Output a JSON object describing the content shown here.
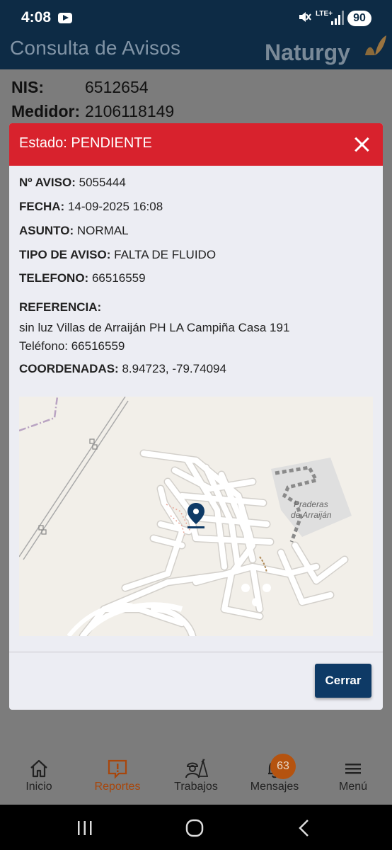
{
  "status_bar": {
    "time": "4:08",
    "network": "LTE+",
    "battery": "90"
  },
  "app": {
    "title": "Consulta de Avisos",
    "brand": "Naturgy"
  },
  "background": {
    "nis_label": "NIS:",
    "nis_value": "6512654",
    "medidor_label": "Medidor:",
    "medidor_value": "2106118149"
  },
  "modal": {
    "title": "Estado: PENDIENTE",
    "header_color": "#d8222d",
    "fields": [
      {
        "label": "Nº AVISO:",
        "value": "5055444"
      },
      {
        "label": "FECHA:",
        "value": "14-09-2025 16:08"
      },
      {
        "label": "ASUNTO:",
        "value": "NORMAL"
      },
      {
        "label": "TIPO DE AVISO:",
        "value": "FALTA DE FLUIDO"
      },
      {
        "label": "TELEFONO:",
        "value": "66516559"
      }
    ],
    "referencia_label": "REFERENCIA:",
    "referencia_line1": "sin luz Villas de Arraiján PH LA Campiña Casa 191",
    "referencia_line2": "Teléfono: 66516559",
    "coordenadas_label": "COORDENADAS:",
    "coordenadas_value": "8.94723, -79.74094",
    "map": {
      "place_line1": "Praderas",
      "place_line2": "de Arraiján",
      "marker_icon": "location-pin-icon"
    },
    "close_button": "Cerrar"
  },
  "bottom_nav": {
    "items": [
      {
        "label": "Inicio",
        "icon": "home-icon"
      },
      {
        "label": "Reportes",
        "icon": "report-alert-icon",
        "active": true
      },
      {
        "label": "Trabajos",
        "icon": "worker-icon"
      },
      {
        "label": "Mensajes",
        "icon": "bell-icon",
        "badge": "63"
      },
      {
        "label": "Menú",
        "icon": "hamburger-menu-icon"
      }
    ],
    "active_color": "#a8460b"
  }
}
